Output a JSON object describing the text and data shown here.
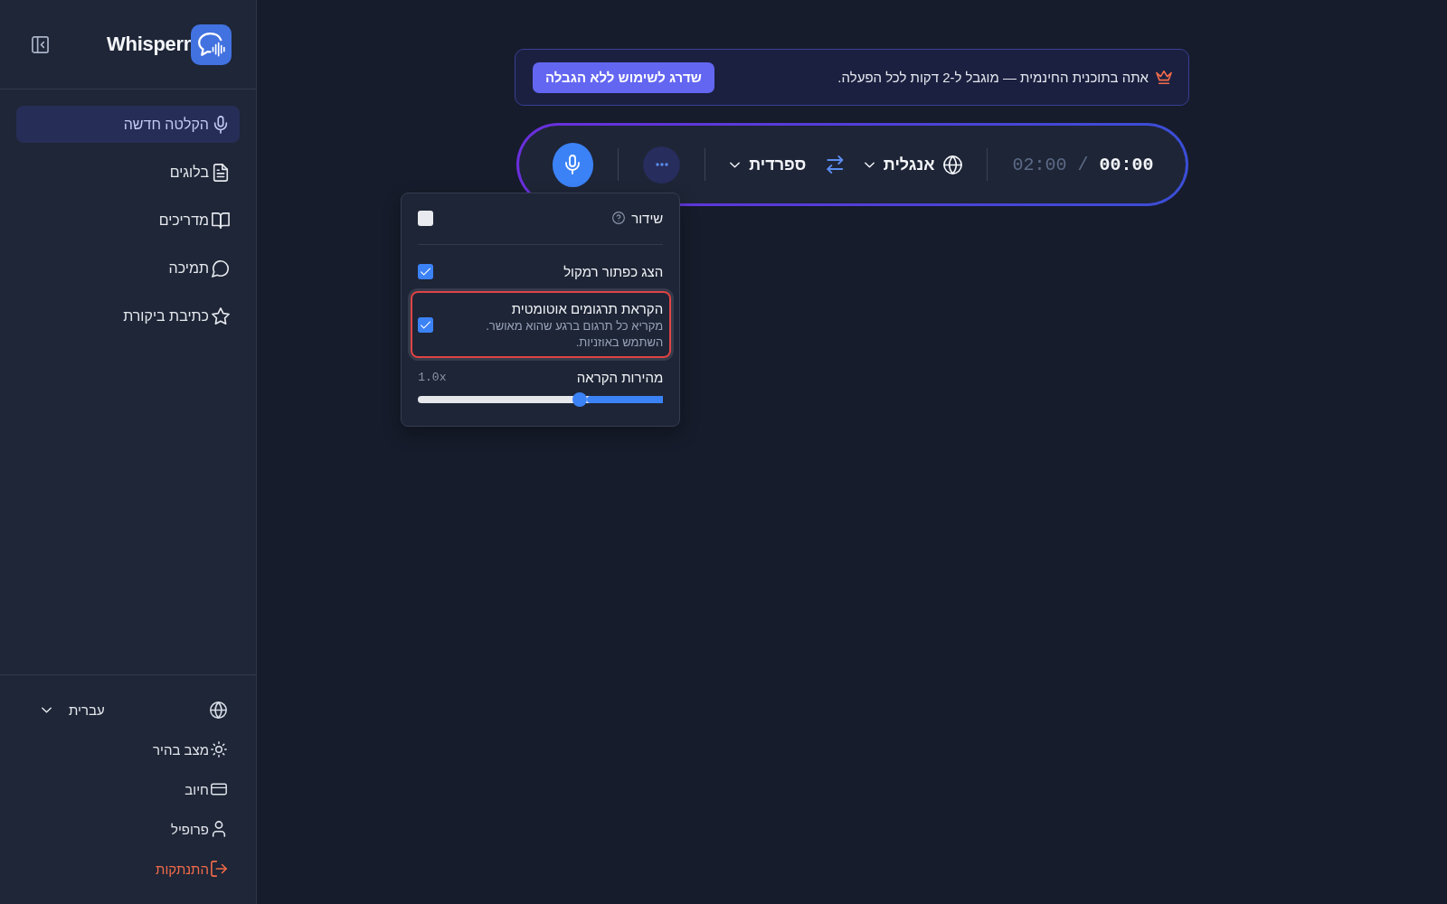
{
  "sidebar": {
    "logo": "Whisperr",
    "nav_items": [
      {
        "label": "הקלטה חדשה",
        "selected": true
      },
      {
        "label": "בלוגים",
        "selected": false
      },
      {
        "label": "מדריכים",
        "selected": false
      },
      {
        "label": "תמיכה",
        "selected": false
      },
      {
        "label": "כתיבת ביקורת",
        "selected": false
      }
    ],
    "language": "עברית",
    "footer_items": [
      {
        "label": "מצב בהיר",
        "kind": "setting"
      },
      {
        "label": "חיוב",
        "kind": "setting"
      },
      {
        "label": "פרופיל",
        "kind": "setting"
      },
      {
        "label": "התנתקות",
        "kind": "logout"
      }
    ]
  },
  "banner": {
    "text": "אתה בתוכנית החינמית — מוגבל ל-2 דקות לכל הפעלה.",
    "button": "שדרג לשימוש ללא הגבלה"
  },
  "recorder": {
    "elapsed": "00:00",
    "separator": "/",
    "limit": "02:00",
    "source_language": "אנגלית",
    "target_language": "ספרדית"
  },
  "settings_popup": {
    "broadcast": {
      "label": "שידור",
      "help": true,
      "checked": false
    },
    "options": [
      {
        "label": "הצג כפתור רמקול",
        "checked": true,
        "highlighted": false
      },
      {
        "label": "הקראת תרגומים אוטומטית",
        "description": "מקריא כל תרגום ברגע שהוא מאושר. השתמש באוזניות.",
        "checked": true,
        "highlighted": true
      }
    ],
    "speed": {
      "label": "מהירות הקראה",
      "reading": "1.0x",
      "level": 0.34
    }
  }
}
